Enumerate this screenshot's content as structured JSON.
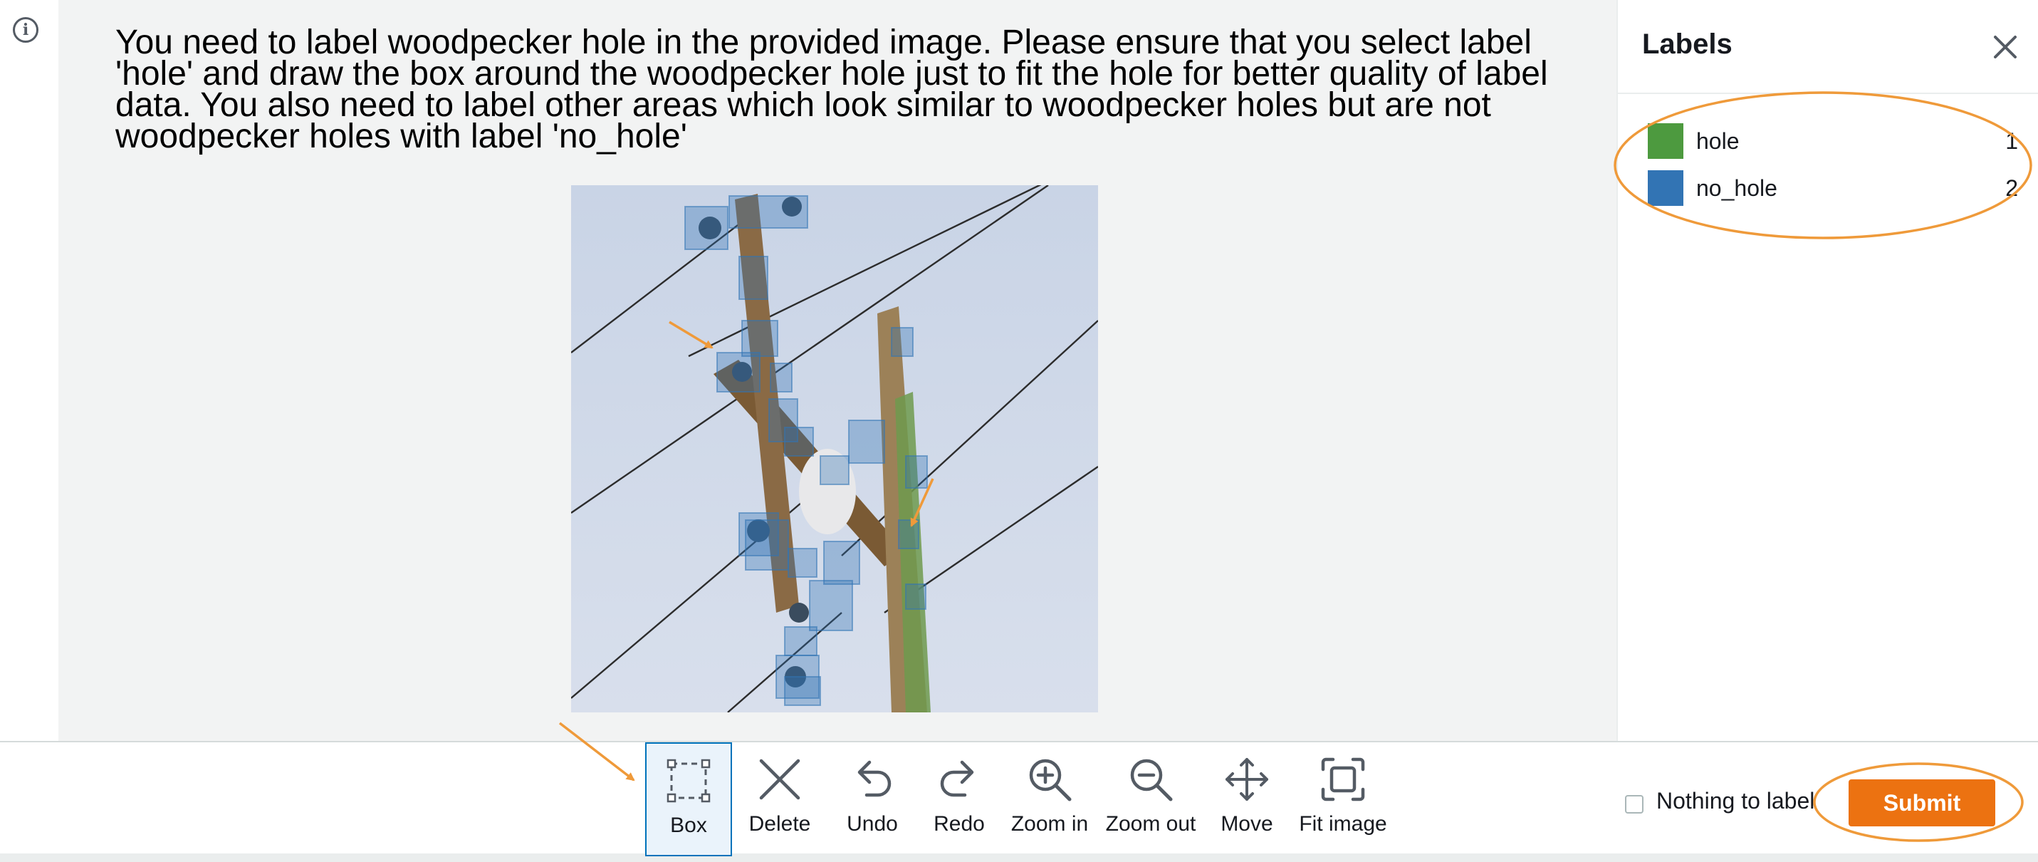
{
  "instructions": "You need to label woodpecker hole in the provided image. Please ensure that you select label 'hole' and draw the box around the woodpecker hole just to fit the hole for better quality of label data. You also need to label other areas which look similar to woodpecker holes but are not woodpecker holes with label 'no_hole'",
  "info_icon": "info-icon",
  "labels_panel": {
    "title": "Labels",
    "close_icon": "close-icon",
    "items": [
      {
        "name": "hole",
        "count": "1",
        "color": "#4d9a3f"
      },
      {
        "name": "no_hole",
        "count": "2",
        "color": "#3274b4"
      }
    ]
  },
  "toolbar": {
    "tools": [
      {
        "label": "Box",
        "icon": "box-icon",
        "selected": true
      },
      {
        "label": "Delete",
        "icon": "delete-icon"
      },
      {
        "label": "Undo",
        "icon": "undo-icon"
      },
      {
        "label": "Redo",
        "icon": "redo-icon"
      },
      {
        "label": "Zoom in",
        "icon": "zoom-in-icon"
      },
      {
        "label": "Zoom out",
        "icon": "zoom-out-icon"
      },
      {
        "label": "Move",
        "icon": "move-icon"
      },
      {
        "label": "Fit image",
        "icon": "fit-image-icon"
      }
    ],
    "nothing_to_label": "Nothing to label",
    "submit": "Submit"
  },
  "colors": {
    "accent": "#ec7211",
    "annotation": "#ef9a3a",
    "selected_tool": "#0073bb",
    "canvas_background": "#f2f3f3"
  }
}
